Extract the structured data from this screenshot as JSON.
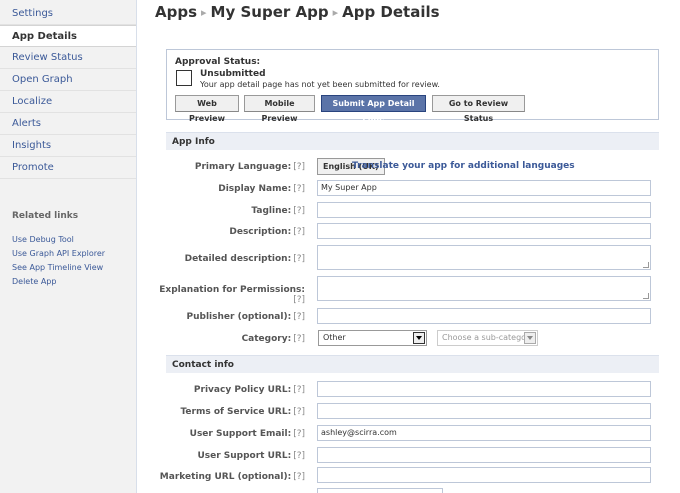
{
  "sidebar": {
    "items": [
      {
        "label": "Settings"
      },
      {
        "label": "App Details"
      },
      {
        "label": "Review Status"
      },
      {
        "label": "Open Graph"
      },
      {
        "label": "Localize"
      },
      {
        "label": "Alerts"
      },
      {
        "label": "Insights"
      },
      {
        "label": "Promote"
      }
    ],
    "related_title": "Related links",
    "related_links": [
      {
        "label": "Use Debug Tool"
      },
      {
        "label": "Use Graph API Explorer"
      },
      {
        "label": "See App Timeline View"
      },
      {
        "label": "Delete App"
      }
    ]
  },
  "breadcrumb": {
    "root": "Apps",
    "app": "My Super App",
    "page": "App Details",
    "separator": "▸"
  },
  "approval": {
    "label": "Approval Status:",
    "status": "Unsubmitted",
    "note": "Your app detail page has not yet been submitted for review.",
    "buttons": {
      "web_preview": "Web Preview",
      "mobile_preview": "Mobile Preview",
      "submit": "Submit App Detail Page",
      "review_status": "Go to Review Status"
    }
  },
  "help_marker": "[?]",
  "app_info": {
    "section_title": "App Info",
    "primary_language_label": "Primary Language:",
    "primary_language_value": "English (UK)",
    "translate_link": "Translate your app for additional languages",
    "display_name_label": "Display Name:",
    "display_name_value": "My Super App",
    "tagline_label": "Tagline:",
    "description_label": "Description:",
    "detailed_description_label": "Detailed description:",
    "permissions_label": "Explanation for Permissions:",
    "publisher_label": "Publisher (optional):",
    "category_label": "Category:",
    "category_value": "Other",
    "subcategory_placeholder": "Choose a sub-category"
  },
  "contact_info": {
    "section_title": "Contact info",
    "privacy_label": "Privacy Policy URL:",
    "tos_label": "Terms of Service URL:",
    "support_email_label": "User Support Email:",
    "support_email_value": "ashley@scirra.com",
    "support_url_label": "User Support URL:",
    "marketing_url_label": "Marketing URL (optional):"
  },
  "colors": {
    "link": "#3b5998",
    "primary_button": "#5b74a8",
    "section_bg": "#eceff5"
  }
}
